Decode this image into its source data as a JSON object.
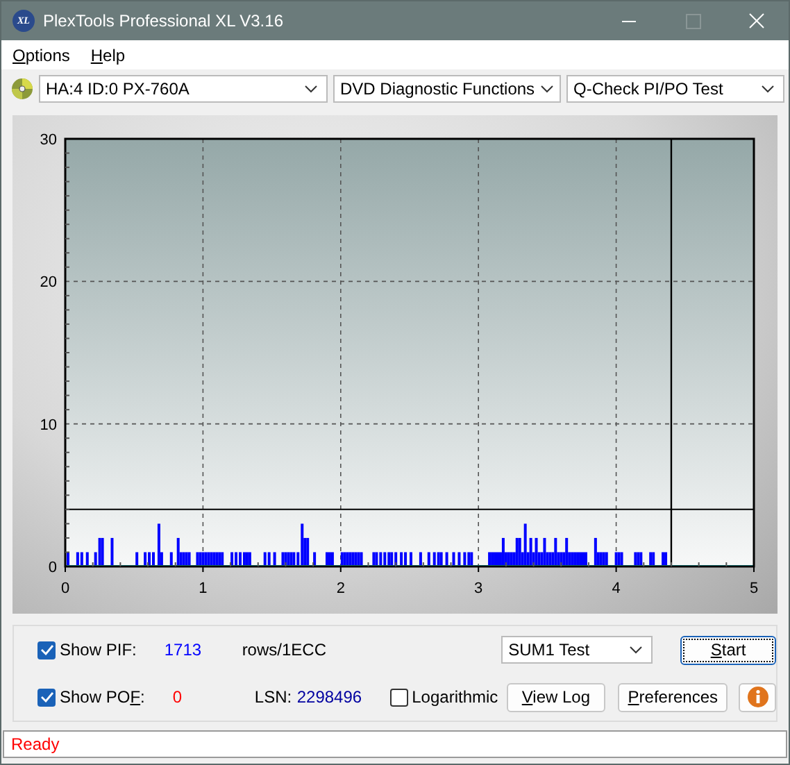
{
  "window": {
    "logo_text": "XL",
    "title": "PlexTools Professional XL V3.16",
    "controls": [
      {
        "kind": "minimize",
        "disabled": false
      },
      {
        "kind": "maximize",
        "disabled": true
      },
      {
        "kind": "close",
        "disabled": false
      }
    ]
  },
  "menu": [
    {
      "key": "O",
      "post": "ptions"
    },
    {
      "key": "H",
      "post": "elp"
    }
  ],
  "toolbar": {
    "dropdowns": [
      {
        "value": "HA:4 ID:0  PX-760A"
      },
      {
        "value": "DVD Diagnostic Functions"
      },
      {
        "value": "Q-Check PI/PO Test"
      }
    ]
  },
  "chart": {
    "chart_data": {
      "type": "bar",
      "grid": true,
      "xlim": [
        0,
        5
      ],
      "ylim": [
        0,
        30
      ],
      "xticks": [
        0,
        1,
        2,
        3,
        4,
        5
      ],
      "yticks": [
        0,
        10,
        20,
        30
      ],
      "x": [
        0.01,
        0.08,
        0.11,
        0.15,
        0.21,
        0.24,
        0.26,
        0.33,
        0.51,
        0.57,
        0.6,
        0.63,
        0.67,
        0.69,
        0.76,
        0.81,
        0.83,
        0.85,
        0.87,
        0.89,
        0.95,
        0.97,
        0.99,
        1.01,
        1.03,
        1.05,
        1.07,
        1.09,
        1.11,
        1.13,
        1.2,
        1.23,
        1.26,
        1.29,
        1.31,
        1.33,
        1.44,
        1.47,
        1.51,
        1.57,
        1.59,
        1.61,
        1.63,
        1.65,
        1.68,
        1.71,
        1.73,
        1.75,
        1.8,
        1.89,
        1.91,
        1.93,
        2.0,
        2.02,
        2.04,
        2.06,
        2.08,
        2.1,
        2.12,
        2.14,
        2.23,
        2.25,
        2.28,
        2.31,
        2.34,
        2.36,
        2.39,
        2.43,
        2.46,
        2.5,
        2.57,
        2.63,
        2.67,
        2.7,
        2.72,
        2.76,
        2.81,
        2.85,
        2.89,
        2.92,
        2.94,
        3.07,
        3.09,
        3.11,
        3.13,
        3.15,
        3.17,
        3.19,
        3.21,
        3.23,
        3.25,
        3.27,
        3.29,
        3.31,
        3.33,
        3.35,
        3.37,
        3.39,
        3.41,
        3.43,
        3.45,
        3.47,
        3.49,
        3.51,
        3.53,
        3.55,
        3.57,
        3.59,
        3.61,
        3.63,
        3.65,
        3.67,
        3.69,
        3.71,
        3.73,
        3.75,
        3.77,
        3.84,
        3.86,
        3.88,
        3.9,
        3.92,
        3.99,
        4.01,
        4.03,
        4.13,
        4.15,
        4.17,
        4.24,
        4.26,
        4.33,
        4.35
      ],
      "series": [
        {
          "color": "#0000ff",
          "values": [
            1,
            1,
            1,
            1,
            1,
            2,
            2,
            2,
            1,
            1,
            1,
            1,
            3,
            1,
            1,
            2,
            1,
            1,
            1,
            1,
            1,
            1,
            1,
            1,
            1,
            1,
            1,
            1,
            1,
            1,
            1,
            1,
            1,
            1,
            1,
            1,
            1,
            1,
            1,
            1,
            1,
            1,
            1,
            1,
            1,
            3,
            2,
            2,
            1,
            1,
            1,
            1,
            1,
            1,
            1,
            1,
            1,
            1,
            1,
            1,
            1,
            1,
            1,
            1,
            1,
            1,
            1,
            1,
            1,
            1,
            1,
            1,
            1,
            1,
            1,
            1,
            1,
            1,
            1,
            1,
            1,
            1,
            1,
            1,
            1,
            1,
            2,
            1,
            1,
            1,
            1,
            2,
            2,
            1,
            3,
            1,
            2,
            1,
            2,
            1,
            1,
            2,
            1,
            1,
            1,
            2,
            1,
            1,
            1,
            2,
            1,
            1,
            1,
            1,
            1,
            1,
            1,
            2,
            1,
            1,
            1,
            1,
            1,
            1,
            1,
            1,
            1,
            1,
            1,
            1,
            1,
            1
          ]
        }
      ],
      "ref_lines": [
        {
          "axis": "y",
          "value": 4
        },
        {
          "axis": "x",
          "value": 4.4
        }
      ]
    }
  },
  "options": {
    "row1": {
      "checkbox": {
        "pre": "Show PIF:",
        "checked": true
      },
      "count": "1713",
      "unit": "rows/1ECC",
      "select": "SUM1 Test",
      "button": {
        "key": "S",
        "post": "tart"
      }
    },
    "row2": {
      "checkbox": {
        "pre": "Show PO",
        "key": "F",
        "post": ":",
        "checked": true
      },
      "count": "0",
      "lsn_label": "LSN:",
      "lsn_value": "2298496",
      "log_checkbox": {
        "label": "Logarithmic",
        "checked": false
      },
      "buttons": [
        {
          "key": "V",
          "post": "iew Log"
        },
        {
          "key": "P",
          "post": "references"
        }
      ]
    }
  },
  "status_bar": {
    "text": "Ready"
  }
}
